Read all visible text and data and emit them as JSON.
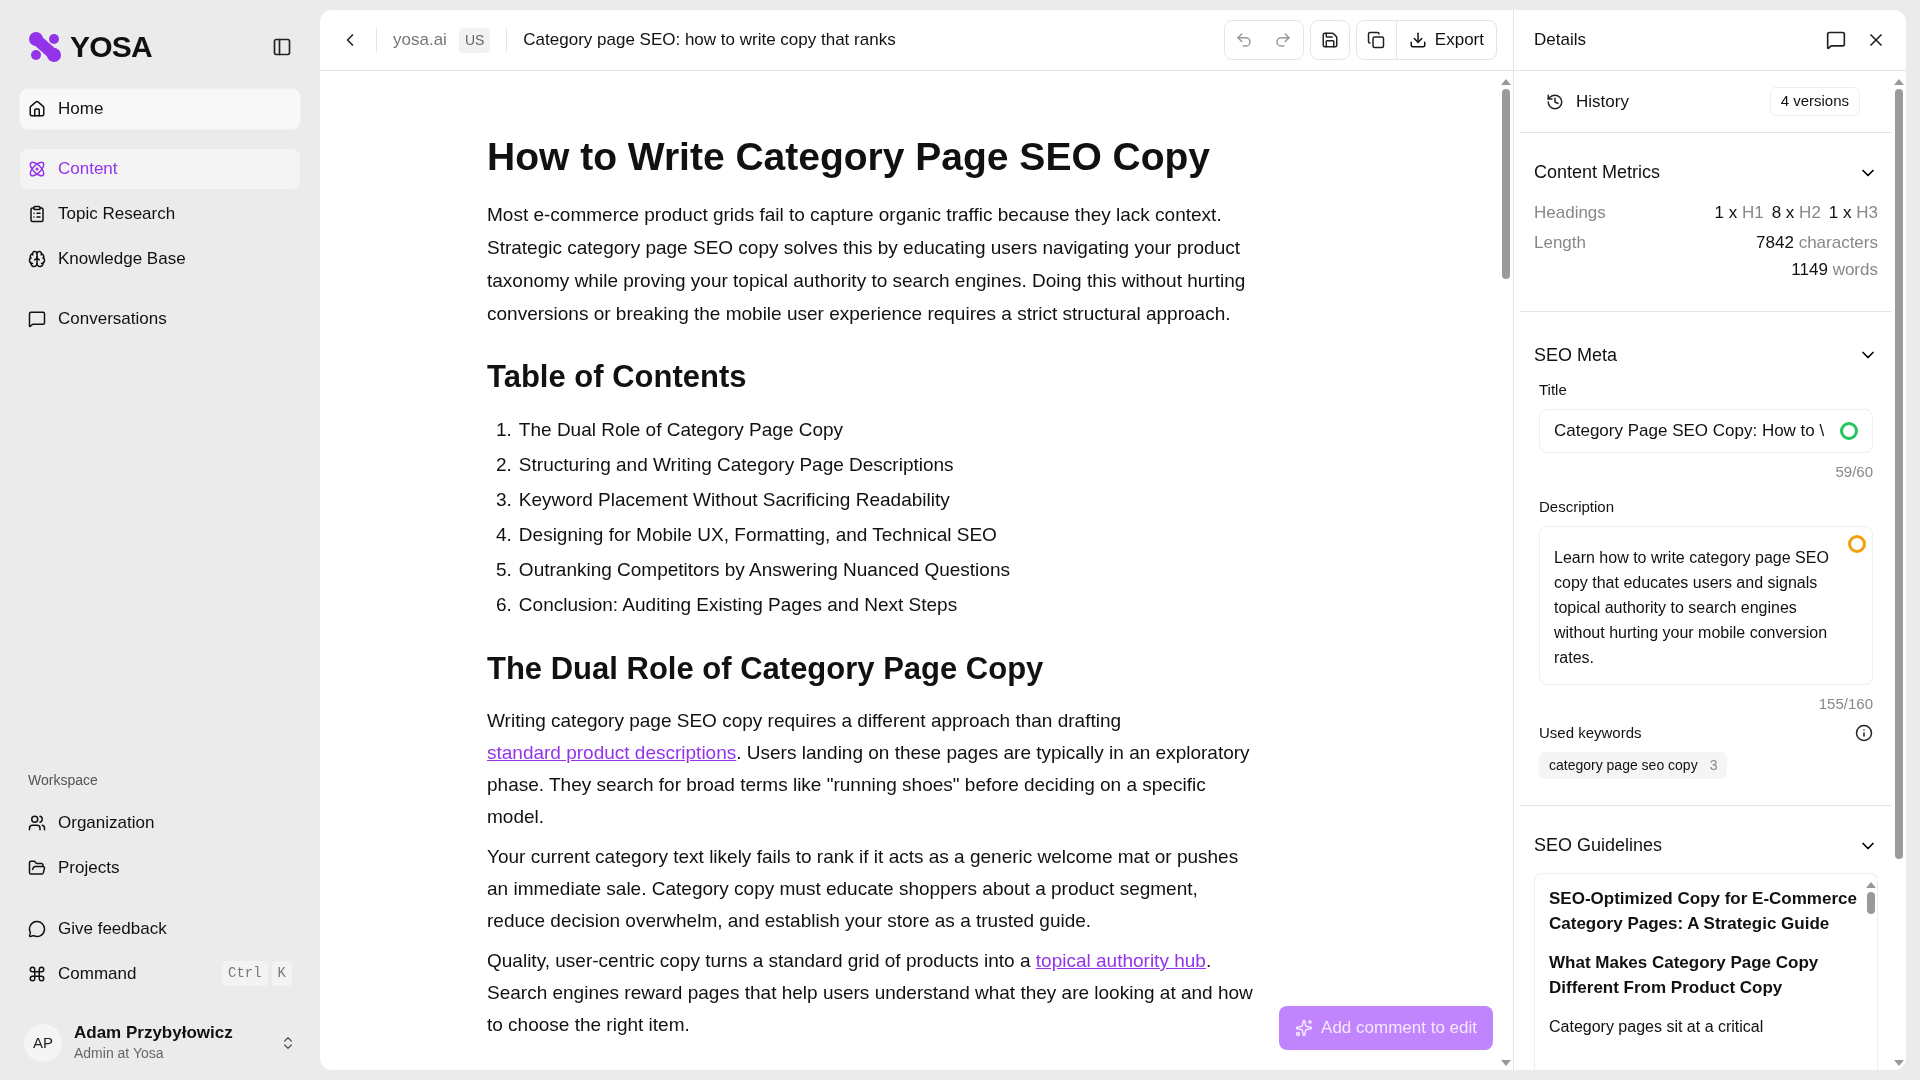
{
  "sidebar": {
    "logo": "YOSA",
    "nav": [
      {
        "label": "Home",
        "selected": false,
        "hovered": true
      },
      {
        "label": "Content",
        "selected": true,
        "hovered": false
      },
      {
        "label": "Topic Research",
        "selected": false,
        "hovered": false
      },
      {
        "label": "Knowledge Base",
        "selected": false,
        "hovered": false
      },
      {
        "label": "Conversations",
        "selected": false,
        "hovered": false
      }
    ],
    "workspace_label": "Workspace",
    "workspace": [
      {
        "label": "Organization"
      },
      {
        "label": "Projects"
      }
    ],
    "feedback": "Give feedback",
    "command": {
      "label": "Command",
      "keys": [
        "Ctrl",
        "K"
      ]
    },
    "user": {
      "initials": "AP",
      "name": "Adam Przybyłowicz",
      "role": "Admin at Yosa"
    }
  },
  "toolbar": {
    "site": "yosa.ai",
    "locale": "US",
    "title": "Category page SEO: how to write copy that ranks",
    "export": "Export"
  },
  "document": {
    "h1": "How to Write Category Page SEO Copy",
    "intro": "Most e-commerce product grids fail to capture organic traffic because they lack context. Strategic category page SEO copy solves this by educating users navigating your product taxonomy while proving your topical authority to search engines. Doing this without hurting conversions or breaking the mobile user experience requires a strict structural approach.",
    "toc_heading": "Table of Contents",
    "toc": [
      {
        "number": "1.",
        "text": "The Dual Role of Category Page Copy"
      },
      {
        "number": "2.",
        "text": "Structuring and Writing Category Page Descriptions"
      },
      {
        "number": "3.",
        "text": "Keyword Placement Without Sacrificing Readability"
      },
      {
        "number": "4.",
        "text": "Designing for Mobile UX, Formatting, and Technical SEO"
      },
      {
        "number": "5.",
        "text": "Outranking Competitors by Answering Nuanced Questions"
      },
      {
        "number": "6.",
        "text": "Conclusion: Auditing Existing Pages and Next Steps"
      }
    ],
    "h2": "The Dual Role of Category Page Copy",
    "paragraphs": [
      [
        {
          "text": "Writing category page SEO copy requires a different approach than drafting ",
          "link": false
        },
        {
          "text": "standard product descriptions",
          "link": true
        },
        {
          "text": ". Users landing on these pages are typically in an exploratory phase. They search for broad terms like \"running shoes\" before deciding on a specific model.",
          "link": false
        }
      ],
      [
        {
          "text": "Your current category text likely fails to rank if it acts as a generic welcome mat or pushes an immediate sale. Category copy must educate shoppers about a product segment, reduce decision overwhelm, and establish your store as a trusted guide.",
          "link": false
        }
      ],
      [
        {
          "text": "Quality, user-centric copy turns a standard grid of products into a ",
          "link": false
        },
        {
          "text": "topical authority hub",
          "link": true
        },
        {
          "text": ". Search engines reward pages that help users understand what they are looking at and how to choose the right item.",
          "link": false
        }
      ]
    ],
    "comment_button": {
      "label": "Add comment to edit",
      "disabled": true
    }
  },
  "details": {
    "title": "Details",
    "history": {
      "label": "History",
      "badge": "4 versions"
    },
    "metrics": {
      "title": "Content Metrics",
      "expanded": true,
      "headings_label": "Headings",
      "headings": [
        {
          "count": "1 x",
          "tag": "H1"
        },
        {
          "count": "8 x",
          "tag": "H2"
        },
        {
          "count": "1 x",
          "tag": "H3"
        }
      ],
      "length_label": "Length",
      "length": [
        {
          "value": "7842",
          "unit": "characters"
        },
        {
          "value": "1149",
          "unit": "words"
        }
      ]
    },
    "seo_meta": {
      "title": "SEO Meta",
      "expanded": true,
      "title_field": {
        "label": "Title",
        "value": "Category Page SEO Copy: How to \\",
        "color": "#22c55e",
        "counter": "59/60"
      },
      "description_field": {
        "label": "Description",
        "value": "Learn how to write category page SEO copy that educates users and signals topical authority to search engines without hurting your mobile conversion rates.",
        "color": "#f59e0b",
        "counter": "155/160"
      },
      "keywords_label": "Used keywords",
      "keywords": [
        {
          "text": "category page seo copy",
          "count": "3"
        }
      ]
    },
    "guidelines": {
      "title": "SEO Guidelines",
      "expanded": true,
      "items": [
        {
          "kind": "heading",
          "text": "SEO-Optimized Copy for E-Commerce Category Pages: A Strategic Guide"
        },
        {
          "kind": "heading",
          "text": "What Makes Category Page Copy Different From Product Copy"
        },
        {
          "kind": "paragraph",
          "text": "Category pages sit at a critical"
        }
      ]
    }
  }
}
